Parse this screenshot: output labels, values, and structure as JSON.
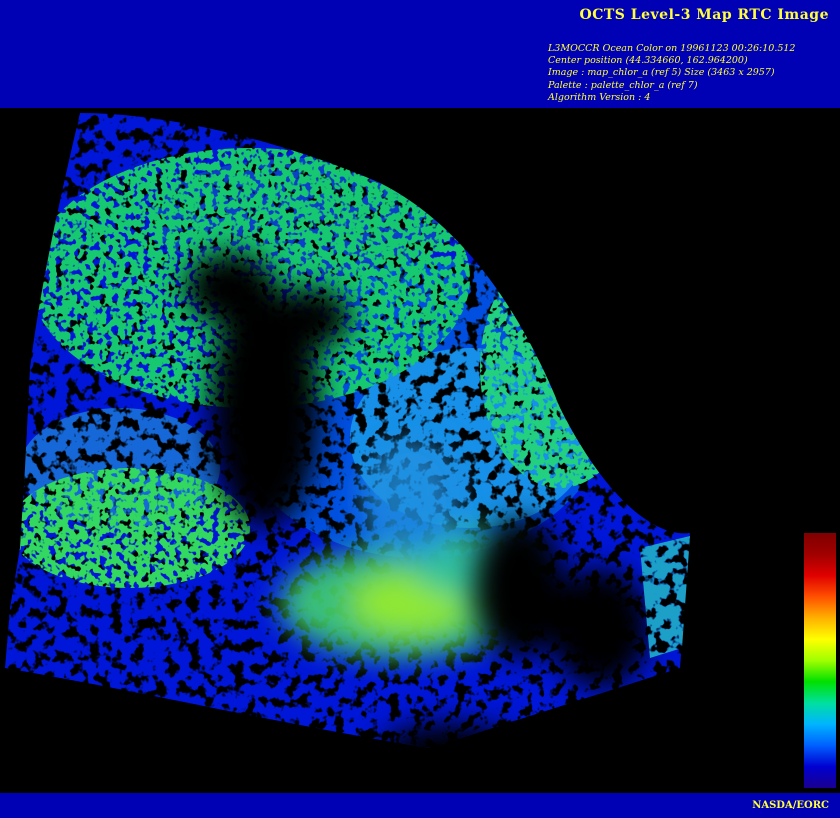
{
  "header": {
    "title": "OCTS Level-3 Map RTC Image",
    "lines": [
      "L3MOCCR Ocean Color on 19961123 00:26:10.512",
      "Center position (44.334660, 162.964200)",
      "Image : map_chlor_a (ref 5) Size (3463 x 2957)",
      "Palette : palette_chlor_a (ref 7)",
      "Algorithm Version : 4"
    ]
  },
  "image": {
    "subject": "satellite ocean chlorophyll-a concentration map",
    "background_color": "#000000"
  },
  "colorbar": {
    "palette": [
      "#1a0090",
      "#0000d0",
      "#0060ff",
      "#00b4ff",
      "#00e0a0",
      "#00e000",
      "#a0ff00",
      "#ffff00",
      "#ffb000",
      "#ff5000",
      "#e00000",
      "#a00000",
      "#800000"
    ]
  },
  "footer": {
    "credit": "NASDA/EORC"
  },
  "colors": {
    "banner": "#0000b4",
    "text": "#ffff3c"
  }
}
